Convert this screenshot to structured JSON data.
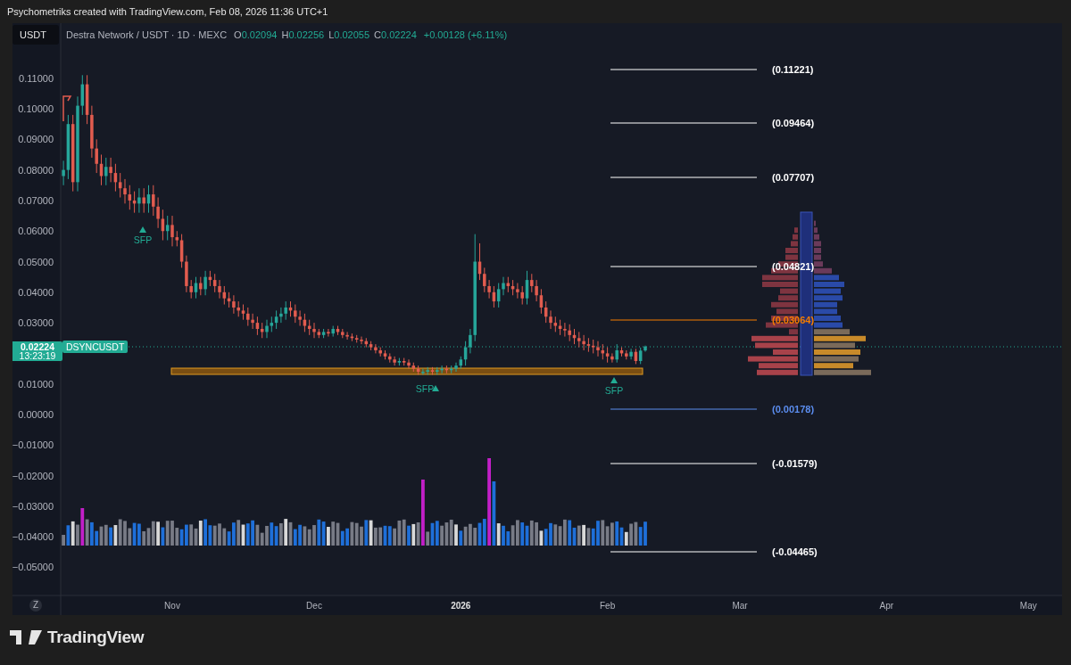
{
  "header": {
    "text": "Psychometriks created with TradingView.com, Feb 08, 2026 11:36 UTC+1"
  },
  "legend": {
    "currency_button": "USDT",
    "symbol": "Destra Network / USDT · 1D · MEXC",
    "ohlc": [
      {
        "label": "O",
        "value": "0.02094"
      },
      {
        "label": "H",
        "value": "0.02256"
      },
      {
        "label": "L",
        "value": "0.02055"
      },
      {
        "label": "C",
        "value": "0.02224"
      }
    ],
    "change": "+0.00128 (+6.11%)"
  },
  "chart_data": {
    "type": "candlestick",
    "yticks": [
      {
        "value": 0.11,
        "label": "0.11000"
      },
      {
        "value": 0.1,
        "label": "0.10000"
      },
      {
        "value": 0.09,
        "label": "0.09000"
      },
      {
        "value": 0.08,
        "label": "0.08000"
      },
      {
        "value": 0.07,
        "label": "0.07000"
      },
      {
        "value": 0.06,
        "label": "0.06000"
      },
      {
        "value": 0.05,
        "label": "0.05000"
      },
      {
        "value": 0.04,
        "label": "0.04000"
      },
      {
        "value": 0.03,
        "label": "0.03000"
      },
      {
        "value": 0.01,
        "label": "0.01000"
      },
      {
        "value": 0,
        "label": "0.00000"
      },
      {
        "value": -0.01,
        "label": "−0.01000"
      },
      {
        "value": -0.02,
        "label": "−0.02000"
      },
      {
        "value": -0.03,
        "label": "−0.03000"
      },
      {
        "value": -0.04,
        "label": "−0.04000"
      },
      {
        "value": -0.05,
        "label": "−0.05000"
      }
    ],
    "ylim": [
      -0.0656,
      0.128
    ],
    "categories": [
      null,
      null,
      null,
      null,
      null,
      null,
      null,
      null,
      null,
      null,
      null,
      null,
      null,
      null,
      null,
      null,
      null,
      null,
      null,
      null,
      null,
      null,
      null,
      null,
      null,
      null,
      null,
      null,
      null,
      null,
      null,
      null,
      null,
      null,
      null,
      null,
      null,
      null,
      null,
      null,
      null,
      null,
      null,
      null,
      null,
      null,
      null,
      null,
      null,
      null,
      null,
      null,
      null,
      null,
      null,
      null,
      null,
      null,
      null,
      null,
      null,
      null,
      null,
      null,
      null,
      null,
      null,
      null,
      null,
      null,
      null,
      null,
      null,
      null,
      null,
      null,
      null,
      null,
      null,
      null,
      null,
      null,
      null,
      null,
      null,
      null,
      null,
      null,
      null,
      null,
      null,
      null,
      null,
      null,
      null,
      null,
      null,
      null,
      null,
      null,
      null,
      null,
      null,
      null,
      null,
      null,
      null,
      null,
      null,
      null,
      null,
      null,
      null,
      null,
      null,
      null,
      null,
      null,
      null,
      null,
      null,
      null,
      null,
      null
    ],
    "ohlc": [
      [
        0.078,
        0.083,
        0.075,
        0.08
      ],
      [
        0.08,
        0.098,
        0.077,
        0.095
      ],
      [
        0.095,
        0.098,
        0.073,
        0.076
      ],
      [
        0.076,
        0.104,
        0.073,
        0.101
      ],
      [
        0.101,
        0.111,
        0.098,
        0.108
      ],
      [
        0.108,
        0.111,
        0.095,
        0.098
      ],
      [
        0.098,
        0.101,
        0.084,
        0.087
      ],
      [
        0.087,
        0.09,
        0.079,
        0.082
      ],
      [
        0.082,
        0.085,
        0.075,
        0.078
      ],
      [
        0.078,
        0.084,
        0.075,
        0.081
      ],
      [
        0.081,
        0.084,
        0.076,
        0.079
      ],
      [
        0.079,
        0.082,
        0.073,
        0.076
      ],
      [
        0.076,
        0.079,
        0.071,
        0.074
      ],
      [
        0.074,
        0.077,
        0.069,
        0.072
      ],
      [
        0.072,
        0.075,
        0.067,
        0.07
      ],
      [
        0.07,
        0.073,
        0.066,
        0.069
      ],
      [
        0.069,
        0.074,
        0.066,
        0.071
      ],
      [
        0.071,
        0.074,
        0.066,
        0.069
      ],
      [
        0.069,
        0.075,
        0.066,
        0.072
      ],
      [
        0.072,
        0.075,
        0.065,
        0.068
      ],
      [
        0.068,
        0.071,
        0.061,
        0.064
      ],
      [
        0.064,
        0.067,
        0.057,
        0.06
      ],
      [
        0.06,
        0.065,
        0.057,
        0.062
      ],
      [
        0.062,
        0.065,
        0.055,
        0.058
      ],
      [
        0.058,
        0.06,
        0.055,
        0.057
      ],
      [
        0.057,
        0.059,
        0.048,
        0.05
      ],
      [
        0.05,
        0.052,
        0.04,
        0.042
      ],
      [
        0.042,
        0.044,
        0.038,
        0.04
      ],
      [
        0.04,
        0.045,
        0.038,
        0.043
      ],
      [
        0.043,
        0.045,
        0.039,
        0.041
      ],
      [
        0.041,
        0.047,
        0.039,
        0.045
      ],
      [
        0.045,
        0.047,
        0.042,
        0.044
      ],
      [
        0.044,
        0.046,
        0.04,
        0.042
      ],
      [
        0.042,
        0.044,
        0.038,
        0.04
      ],
      [
        0.04,
        0.042,
        0.036,
        0.038
      ],
      [
        0.038,
        0.04,
        0.035,
        0.037
      ],
      [
        0.037,
        0.039,
        0.033,
        0.035
      ],
      [
        0.035,
        0.037,
        0.032,
        0.034
      ],
      [
        0.034,
        0.036,
        0.031,
        0.033
      ],
      [
        0.033,
        0.035,
        0.029,
        0.031
      ],
      [
        0.031,
        0.033,
        0.028,
        0.03
      ],
      [
        0.03,
        0.032,
        0.026,
        0.028
      ],
      [
        0.028,
        0.03,
        0.025,
        0.027
      ],
      [
        0.027,
        0.031,
        0.025,
        0.029
      ],
      [
        0.029,
        0.032,
        0.027,
        0.03
      ],
      [
        0.03,
        0.034,
        0.028,
        0.032
      ],
      [
        0.032,
        0.035,
        0.03,
        0.033
      ],
      [
        0.033,
        0.037,
        0.031,
        0.035
      ],
      [
        0.035,
        0.037,
        0.032,
        0.034
      ],
      [
        0.034,
        0.036,
        0.03,
        0.032
      ],
      [
        0.032,
        0.034,
        0.029,
        0.031
      ],
      [
        0.031,
        0.033,
        0.027,
        0.029
      ],
      [
        0.029,
        0.031,
        0.026,
        0.028
      ],
      [
        0.028,
        0.03,
        0.025,
        0.027
      ],
      [
        0.027,
        0.028,
        0.025,
        0.026
      ],
      [
        0.026,
        0.028,
        0.025,
        0.027
      ],
      [
        0.027,
        0.028,
        0.0255,
        0.0265
      ],
      [
        0.0265,
        0.029,
        0.0255,
        0.028
      ],
      [
        0.028,
        0.029,
        0.026,
        0.027
      ],
      [
        0.027,
        0.028,
        0.025,
        0.026
      ],
      [
        0.026,
        0.027,
        0.0245,
        0.0255
      ],
      [
        0.0255,
        0.0265,
        0.024,
        0.025
      ],
      [
        0.025,
        0.026,
        0.0235,
        0.0245
      ],
      [
        0.0245,
        0.0255,
        0.023,
        0.024
      ],
      [
        0.024,
        0.025,
        0.022,
        0.023
      ],
      [
        0.023,
        0.024,
        0.021,
        0.022
      ],
      [
        0.022,
        0.023,
        0.02,
        0.021
      ],
      [
        0.021,
        0.022,
        0.019,
        0.02
      ],
      [
        0.02,
        0.021,
        0.018,
        0.019
      ],
      [
        0.019,
        0.02,
        0.017,
        0.018
      ],
      [
        0.018,
        0.019,
        0.016,
        0.017
      ],
      [
        0.017,
        0.0185,
        0.016,
        0.0175
      ],
      [
        0.0175,
        0.0185,
        0.016,
        0.017
      ],
      [
        0.017,
        0.018,
        0.015,
        0.016
      ],
      [
        0.016,
        0.017,
        0.014,
        0.015
      ],
      [
        0.015,
        0.016,
        0.013,
        0.014
      ],
      [
        0.014,
        0.015,
        0.013,
        0.014
      ],
      [
        0.014,
        0.0155,
        0.013,
        0.0145
      ],
      [
        0.0145,
        0.0155,
        0.013,
        0.014
      ],
      [
        0.014,
        0.0155,
        0.013,
        0.0145
      ],
      [
        0.0145,
        0.016,
        0.0135,
        0.015
      ],
      [
        0.015,
        0.016,
        0.0135,
        0.0145
      ],
      [
        0.0145,
        0.016,
        0.0135,
        0.015
      ],
      [
        0.015,
        0.017,
        0.014,
        0.016
      ],
      [
        0.016,
        0.019,
        0.015,
        0.018
      ],
      [
        0.018,
        0.024,
        0.016,
        0.022
      ],
      [
        0.022,
        0.028,
        0.02,
        0.026
      ],
      [
        0.026,
        0.059,
        0.024,
        0.05
      ],
      [
        0.05,
        0.056,
        0.044,
        0.046
      ],
      [
        0.046,
        0.048,
        0.04,
        0.042
      ],
      [
        0.042,
        0.044,
        0.038,
        0.04
      ],
      [
        0.04,
        0.042,
        0.035,
        0.037
      ],
      [
        0.037,
        0.043,
        0.035,
        0.041
      ],
      [
        0.041,
        0.045,
        0.039,
        0.043
      ],
      [
        0.043,
        0.045,
        0.04,
        0.042
      ],
      [
        0.042,
        0.044,
        0.039,
        0.041
      ],
      [
        0.041,
        0.043,
        0.038,
        0.04
      ],
      [
        0.04,
        0.042,
        0.036,
        0.038
      ],
      [
        0.038,
        0.047,
        0.036,
        0.044
      ],
      [
        0.044,
        0.046,
        0.04,
        0.042
      ],
      [
        0.042,
        0.044,
        0.037,
        0.039
      ],
      [
        0.039,
        0.041,
        0.033,
        0.035
      ],
      [
        0.035,
        0.037,
        0.03,
        0.032
      ],
      [
        0.032,
        0.034,
        0.028,
        0.03
      ],
      [
        0.03,
        0.032,
        0.027,
        0.029
      ],
      [
        0.029,
        0.031,
        0.026,
        0.028
      ],
      [
        0.028,
        0.03,
        0.0255,
        0.0275
      ],
      [
        0.0275,
        0.0295,
        0.024,
        0.026
      ],
      [
        0.026,
        0.028,
        0.023,
        0.025
      ],
      [
        0.025,
        0.027,
        0.022,
        0.024
      ],
      [
        0.024,
        0.026,
        0.021,
        0.023
      ],
      [
        0.023,
        0.025,
        0.0205,
        0.0225
      ],
      [
        0.0225,
        0.0245,
        0.02,
        0.022
      ],
      [
        0.022,
        0.024,
        0.019,
        0.021
      ],
      [
        0.021,
        0.023,
        0.018,
        0.02
      ],
      [
        0.02,
        0.022,
        0.017,
        0.019
      ],
      [
        0.019,
        0.02,
        0.017,
        0.018
      ],
      [
        0.018,
        0.023,
        0.017,
        0.021
      ],
      [
        0.021,
        0.022,
        0.019,
        0.02
      ],
      [
        0.02,
        0.021,
        0.018,
        0.019
      ],
      [
        0.019,
        0.0215,
        0.018,
        0.0205
      ],
      [
        0.0205,
        0.0215,
        0.0165,
        0.0175
      ],
      [
        0.0175,
        0.0219,
        0.0165,
        0.0209
      ],
      [
        0.02094,
        0.02256,
        0.02055,
        0.02224
      ]
    ]
  },
  "last_price": {
    "price": "0.02224",
    "countdown": "13:23:19",
    "symbol": "DSYNCUSDT"
  },
  "fib_levels": [
    {
      "label": "(0.11221)",
      "color": "#ffffff"
    },
    {
      "label": "(0.09464)",
      "color": "#ffffff"
    },
    {
      "label": "(0.07707)",
      "color": "#ffffff"
    },
    {
      "label": "(0.04821)",
      "color": "#ffffff"
    },
    {
      "label": "(0.03064)",
      "color": "#f57c00"
    },
    {
      "label": "(0.00178)",
      "color": "#5b8def"
    },
    {
      "label": "(-0.01579)",
      "color": "#ffffff"
    },
    {
      "label": "(-0.04465)",
      "color": "#ffffff"
    }
  ],
  "markers": [
    {
      "label": "SFP"
    },
    {
      "label": "SFP"
    },
    {
      "label": "SFP"
    }
  ],
  "time_axis": {
    "reset_button": "Z",
    "labels": [
      {
        "text": "Nov",
        "kind": "month"
      },
      {
        "text": "Dec",
        "kind": "month"
      },
      {
        "text": "2026",
        "kind": "year"
      },
      {
        "text": "Feb",
        "kind": "month"
      },
      {
        "text": "Mar",
        "kind": "month"
      },
      {
        "text": "Apr",
        "kind": "month"
      },
      {
        "text": "May",
        "kind": "month"
      }
    ]
  },
  "footer": {
    "brand": "TradingView"
  }
}
